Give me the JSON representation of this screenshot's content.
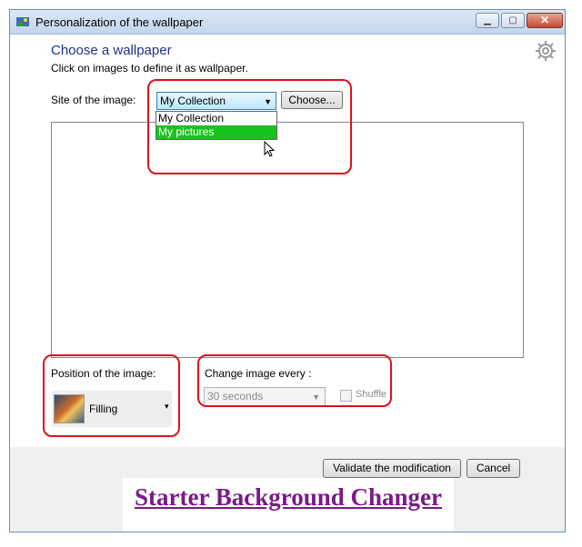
{
  "window": {
    "title": "Personalization of the wallpaper",
    "min_glyph": "▁",
    "max_glyph": "▢",
    "close_glyph": "✕"
  },
  "main": {
    "heading": "Choose a wallpaper",
    "subheading": "Click on images to define it as wallpaper.",
    "site_label": "Site of the image:",
    "site_value": "My Collection",
    "site_options": [
      "My Collection",
      "My pictures"
    ],
    "highlighted_option": "My pictures",
    "choose_label": "Choose..."
  },
  "position": {
    "label": "Position of the image:",
    "value": "Filling"
  },
  "change": {
    "label": "Change image every :",
    "interval": "30 seconds",
    "shuffle_label": "Shuffle",
    "shuffle_checked": false
  },
  "footer": {
    "validate_label": "Validate the modification",
    "cancel_label": "Cancel"
  },
  "banner": {
    "text": "Starter Background Changer"
  },
  "colors": {
    "highlight": "#e0101b",
    "selected_option": "#19c31e",
    "heading": "#1e3287",
    "banner": "#7a1b87"
  },
  "icons": [
    "app-icon",
    "gear-icon",
    "dropdown-arrow-icon",
    "cursor-icon",
    "wallpaper-thumbnail"
  ]
}
